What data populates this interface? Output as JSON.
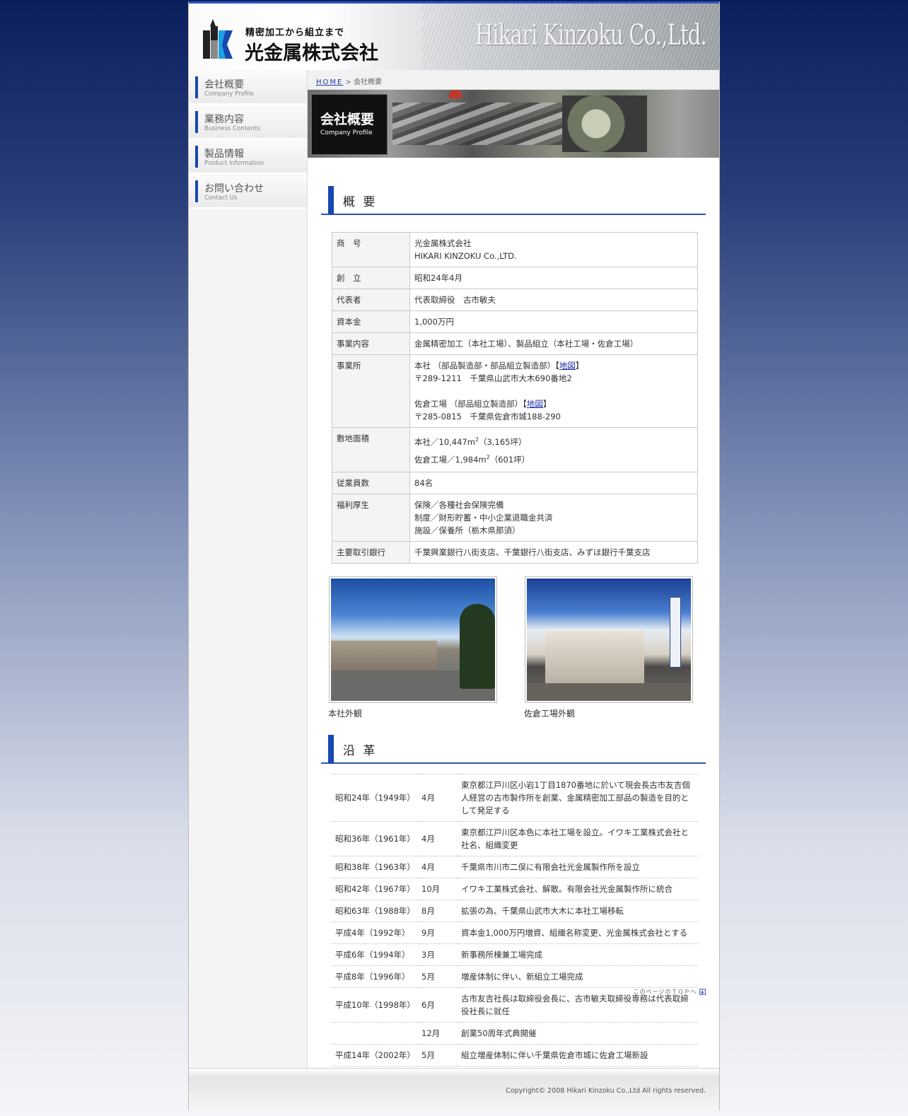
{
  "header": {
    "tagline": "精密加工から組立まで",
    "company_name": "光金属株式会社",
    "english_name": "Hikari Kinzoku Co.,Ltd."
  },
  "sidebar": {
    "items": [
      {
        "jp": "会社概要",
        "en": "Company Profile"
      },
      {
        "jp": "業務内容",
        "en": "Business Contents"
      },
      {
        "jp": "製品情報",
        "en": "Product Information"
      },
      {
        "jp": "お問い合わせ",
        "en": "Contact Us"
      }
    ]
  },
  "breadcrumb": {
    "home": "HOME",
    "sep": " > ",
    "current": "会社概要"
  },
  "banner": {
    "jp": "会社概要",
    "en": "Company Profile"
  },
  "overview": {
    "title": "概 要",
    "rows": [
      {
        "k": "商　号",
        "v1": "光金属株式会社",
        "v2": "HIKARI KINZOKU Co.,LTD."
      },
      {
        "k": "創　立",
        "v1": "昭和24年4月"
      },
      {
        "k": "代表者",
        "v1": "代表取締役　古市敏夫"
      },
      {
        "k": "資本金",
        "v1": "1,000万円"
      },
      {
        "k": "事業内容",
        "v1": "金属精密加工（本社工場）、製品組立（本社工場・佐倉工場）"
      },
      {
        "k": "事業所",
        "honsha": "本社 （部品製造部・部品組立製造部）【",
        "honsha_addr": "〒289-1211　千葉県山武市大木690番地2",
        "sakura": "佐倉工場 （部品組立製造部）【",
        "sakura_addr": "〒285-0815　千葉県佐倉市城188-290",
        "map": "地図",
        "close": "】"
      },
      {
        "k": "敷地面積",
        "v1a": "本社／10,447m",
        "v1b": "（3,165坪）",
        "v2a": "佐倉工場／1,984m",
        "v2b": "（601坪）",
        "sup": "2"
      },
      {
        "k": "従業員数",
        "v1": "84名"
      },
      {
        "k": "福利厚生",
        "v1": "保険／各種社会保険完備",
        "v2": "制度／財形貯蓄・中小企業退職金共済",
        "v3": "施設／保養所（栃木県那須）"
      },
      {
        "k": "主要取引銀行",
        "v1": "千葉興業銀行八街支店、千葉銀行八街支店、みずほ銀行千葉支店"
      }
    ]
  },
  "photos": [
    {
      "caption": "本社外観"
    },
    {
      "caption": "佐倉工場外観"
    }
  ],
  "history": {
    "title": "沿 革",
    "rows": [
      {
        "era": "昭和24年（1949年）",
        "mon": "4月",
        "text": "東京都江戸川区小岩1丁目1870番地に於いて現会長古市友吉個人経営の古市製作所を創業、金属精密加工部品の製造を目的として発足する"
      },
      {
        "era": "昭和36年（1961年）",
        "mon": "4月",
        "text": "東京都江戸川区本色に本社工場を設立。イワキ工業株式会社と社名、組織変更"
      },
      {
        "era": "昭和38年（1963年）",
        "mon": "4月",
        "text": "千葉県市川市二俣に有限会社光金属製作所を設立"
      },
      {
        "era": "昭和42年（1967年）",
        "mon": "10月",
        "text": "イワキ工業株式会社、解散。有限会社光金属製作所に統合"
      },
      {
        "era": "昭和63年（1988年）",
        "mon": "8月",
        "text": "拡張の為、千葉県山武市大木に本社工場移転"
      },
      {
        "era": "平成4年（1992年）",
        "mon": "9月",
        "text": "資本金1,000万円増資、組織名称変更、光金属株式会社とする"
      },
      {
        "era": "平成6年（1994年）",
        "mon": "3月",
        "text": "新事務所棟兼工場完成"
      },
      {
        "era": "平成8年（1996年）",
        "mon": "5月",
        "text": "増産体制に伴い、新組立工場完成"
      },
      {
        "era": "平成10年（1998年）",
        "mon": "6月",
        "text": "古市友吉社長は取締役会長に、古市敏夫取締役専務は代表取締役社長に就任"
      },
      {
        "era": "",
        "mon": "12月",
        "text": "創業50周年式典開催"
      },
      {
        "era": "平成14年（2002年）",
        "mon": "5月",
        "text": "組立増産体制に伴い千葉県佐倉市城に佐倉工場新設"
      }
    ]
  },
  "pagetop": "このページのＴＯＰへ",
  "footer": {
    "copyright": "Copyright© 2008 Hikari Kinzoku Co.,Ltd All rights reserved."
  }
}
